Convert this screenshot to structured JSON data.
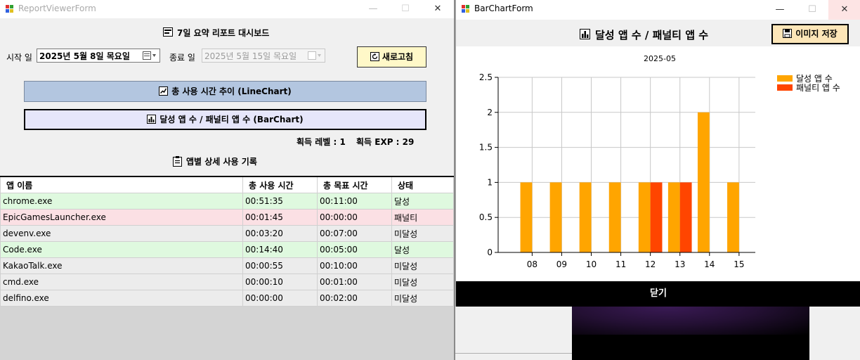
{
  "left_window": {
    "title": "ReportViewerForm",
    "heading": "7일 요약 리포트 대시보드",
    "start_label": "시작 일",
    "start_date": "2025년   5월   8일 목요일",
    "end_label": "종료 일",
    "end_date": "2025년   5월 15일 목요일",
    "refresh_button": "새로고침",
    "line_chart_button": "총 사용 시간 추이 (LineChart)",
    "bar_chart_button": "달성 앱 수 / 패널티 앱 수 (BarChart)",
    "level_text": "획득 레벨 : 1",
    "exp_text": "획득 EXP : 29",
    "detail_heading": "앱별 상세 사용 기록",
    "table": {
      "headers": [
        "앱 이름",
        "총 사용 시간",
        "총 목표 시간",
        "상태"
      ],
      "rows": [
        [
          "chrome.exe",
          "00:51:35",
          "00:11:00",
          "달성"
        ],
        [
          "EpicGamesLauncher.exe",
          "00:01:45",
          "00:00:00",
          "패널티"
        ],
        [
          "devenv.exe",
          "00:03:20",
          "00:07:00",
          "미달성"
        ],
        [
          "Code.exe",
          "00:14:40",
          "00:05:00",
          "달성"
        ],
        [
          "KakaoTalk.exe",
          "00:00:55",
          "00:10:00",
          "미달성"
        ],
        [
          "cmd.exe",
          "00:00:10",
          "00:01:00",
          "미달성"
        ],
        [
          "delfino.exe",
          "00:00:00",
          "00:02:00",
          "미달성"
        ]
      ],
      "row_colors": [
        "#dff9df",
        "#fbe0e4",
        "#ececec",
        "#dff9df",
        "#ececec",
        "#ececec",
        "#ececec"
      ]
    }
  },
  "right_window": {
    "title": "BarChartForm",
    "heading": "달성 앱 수 / 패널티 앱 수",
    "save_button": "이미지 저장",
    "close_button": "닫기"
  },
  "chart_data": {
    "type": "bar",
    "title": "2025-05",
    "categories": [
      "08",
      "09",
      "10",
      "11",
      "12",
      "13",
      "14",
      "15"
    ],
    "series": [
      {
        "name": "달성 앱 수",
        "color": "#ffa500",
        "values": [
          1,
          1,
          1,
          1,
          1,
          1,
          2,
          1
        ]
      },
      {
        "name": "패널티 앱 수",
        "color": "#ff4500",
        "values": [
          0,
          0,
          0,
          0,
          1,
          1,
          0,
          0
        ]
      }
    ],
    "ylim": [
      0,
      2.5
    ],
    "yticks": [
      "0",
      "0.5",
      "1",
      "1.5",
      "2",
      "2.5"
    ],
    "grid": true,
    "legend": "top-right"
  },
  "colors": {
    "line_button_bg": "#b3c6e0",
    "bar_button_bg": "#e6e6fa",
    "refresh_button_bg": "#fff8c8",
    "save_button_bg": "#fde6b8"
  },
  "icons": [
    "app-icon",
    "dashboard-icon",
    "calendar-icon",
    "refresh-icon",
    "checkbox-chart-icon",
    "bar-chart-icon",
    "clipboard-icon",
    "save-icon"
  ]
}
